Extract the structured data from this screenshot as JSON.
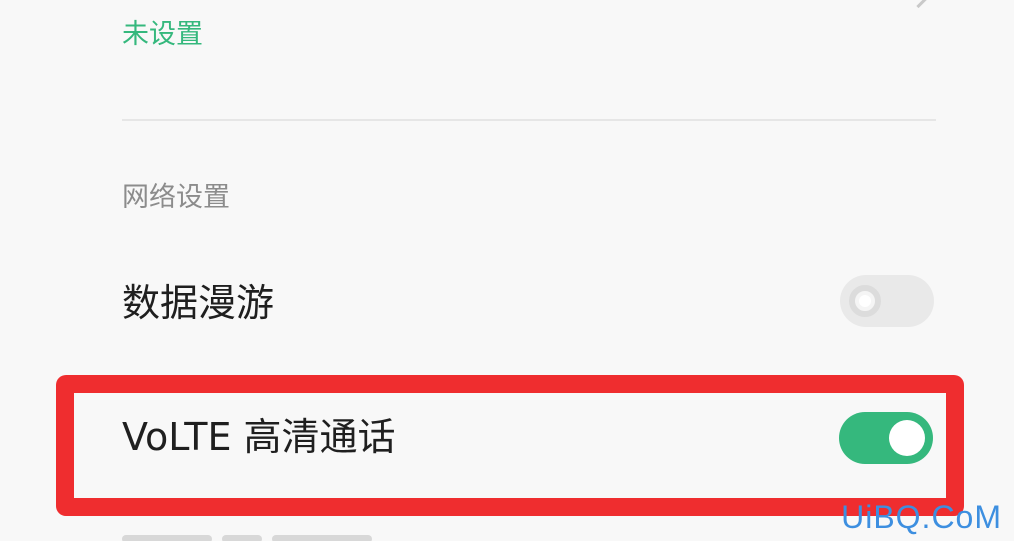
{
  "top_item": {
    "status": "未设置"
  },
  "network_section": {
    "header": "网络设置"
  },
  "settings": [
    {
      "label": "数据漫游",
      "enabled": false
    },
    {
      "label": "VoLTE 高清通话",
      "enabled": true
    }
  ],
  "colors": {
    "accent_green": "#35b87d",
    "highlight_red": "#ef2d2f",
    "watermark_blue": "#3d8fe0"
  },
  "watermark": "UiBQ.CoM",
  "icons": [
    "chevron-right-icon"
  ]
}
